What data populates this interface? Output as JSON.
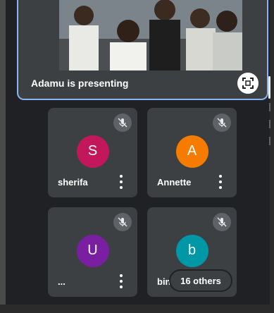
{
  "presenter": {
    "label": "Adamu is presenting"
  },
  "participants": [
    {
      "name": "sherifa",
      "initial": "S",
      "color": "#c2185b",
      "muted": true
    },
    {
      "name": "Annette",
      "initial": "A",
      "color": "#f57c00",
      "muted": true
    },
    {
      "name": "...",
      "initial": "U",
      "color": "#7b1fa2",
      "muted": true
    },
    {
      "name": "bin",
      "initial": "b",
      "color": "#0097a7",
      "muted": true
    }
  ],
  "others": {
    "label": "16 others"
  },
  "icons": {
    "mute": "mic-off-icon",
    "fullscreen": "fullscreen-icon",
    "more": "more-vert-icon"
  }
}
